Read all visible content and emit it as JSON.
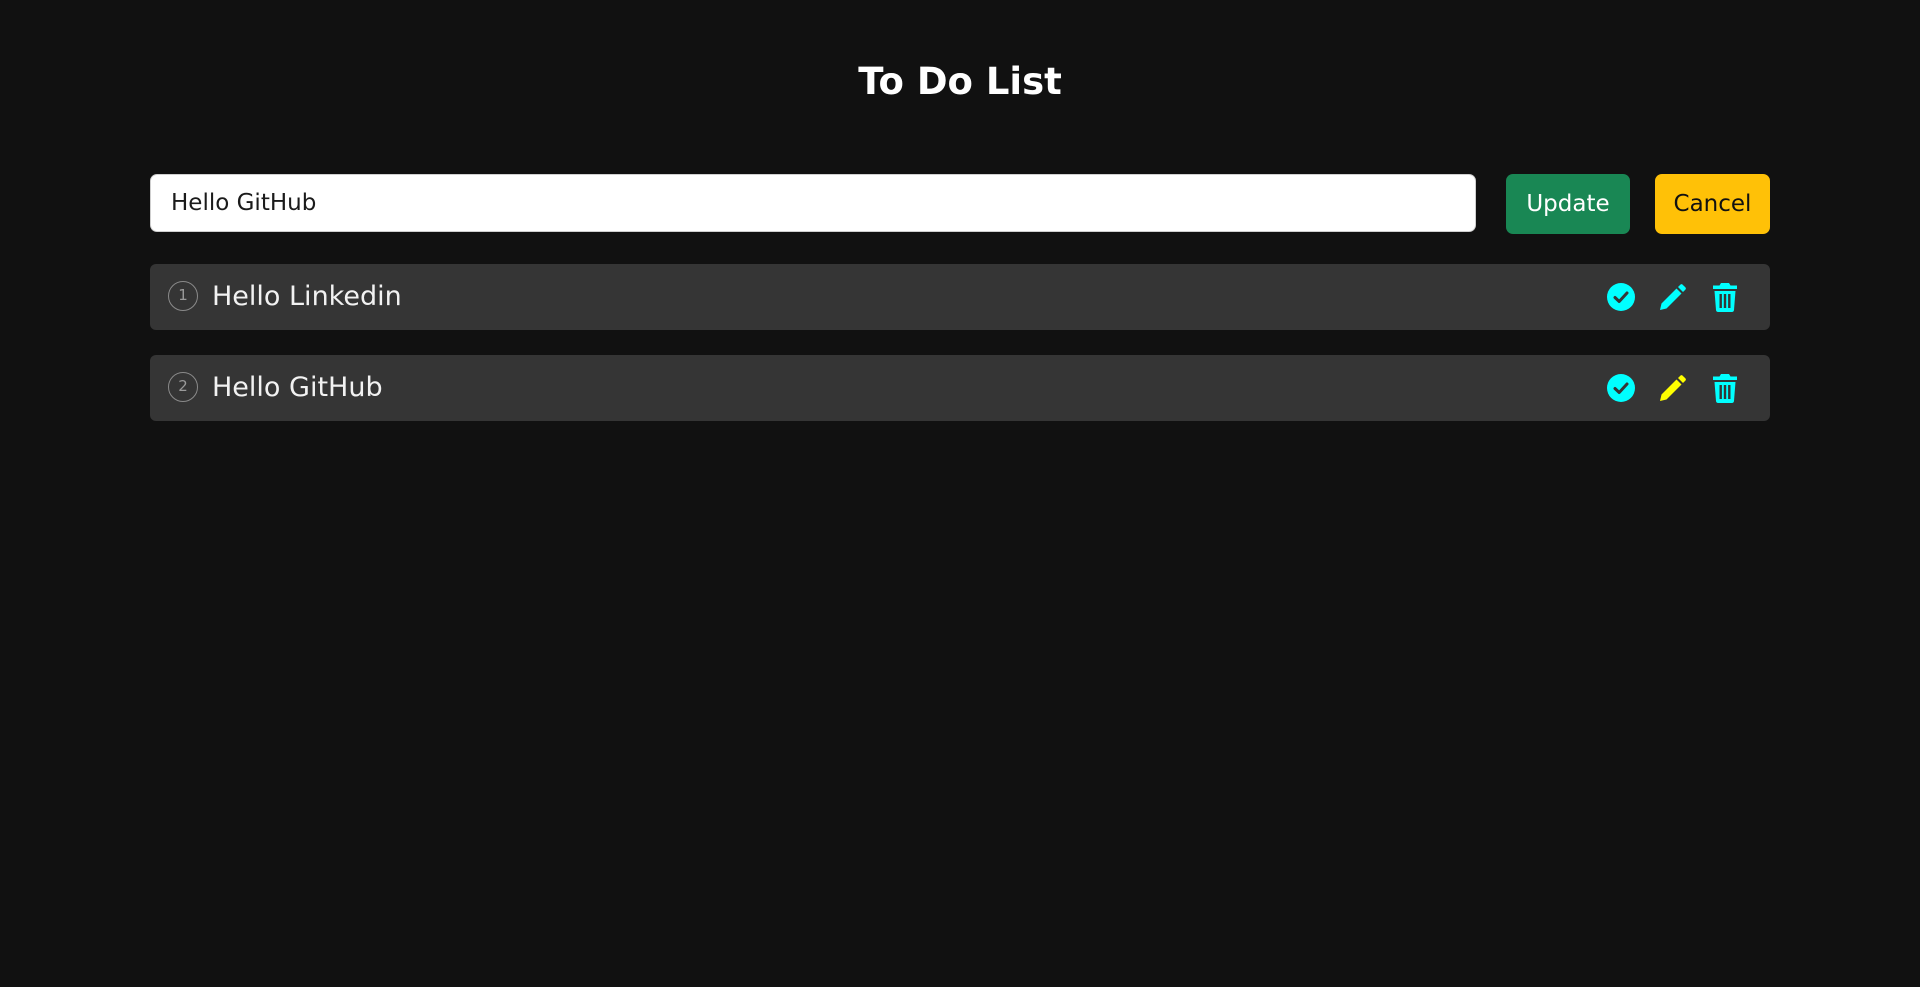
{
  "app": {
    "title": "To Do List"
  },
  "edit": {
    "input_value": "Hello GitHub",
    "update_label": "Update",
    "cancel_label": "Cancel"
  },
  "todos": [
    {
      "number": "1",
      "text": "Hello Linkedin",
      "edit_icon_color": "#00ffff"
    },
    {
      "number": "2",
      "text": "Hello GitHub",
      "edit_icon_color": "#ffff00"
    }
  ],
  "icons": {
    "complete": "check-circle-icon",
    "edit": "pencil-icon",
    "delete": "trash-icon"
  },
  "colors": {
    "background": "#111111",
    "item_background": "#353535",
    "update_button": "#198754",
    "cancel_button": "#ffc107",
    "icon_accent": "#00ffff",
    "active_edit_icon": "#ffff00"
  }
}
